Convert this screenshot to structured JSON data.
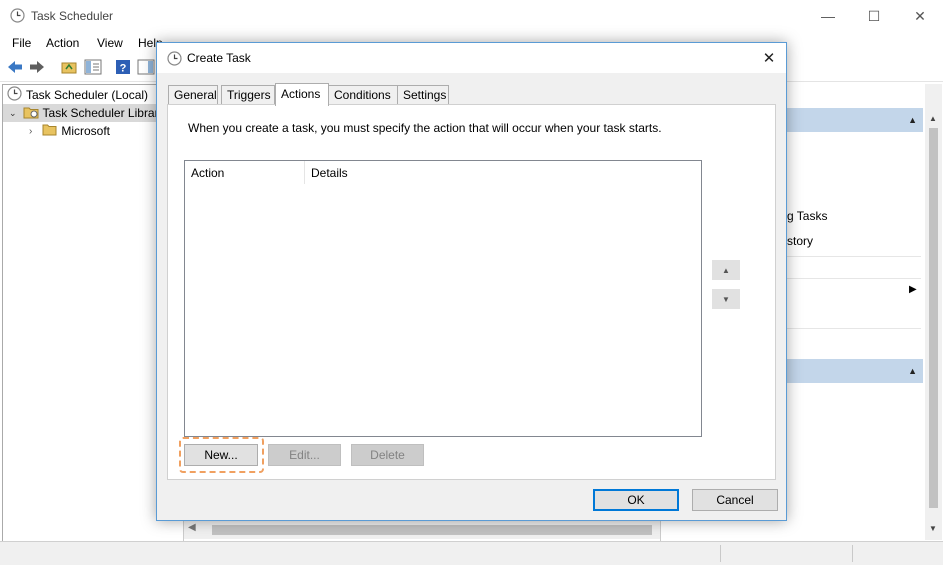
{
  "app": {
    "title": "Task Scheduler",
    "window_controls": {
      "minimize": "—",
      "maximize": "☐",
      "close": "✕"
    }
  },
  "menu": [
    "File",
    "Action",
    "View",
    "Help"
  ],
  "tree": {
    "root": "Task Scheduler (Local)",
    "library": "Task Scheduler Library",
    "child": "Microsoft"
  },
  "right_pane": {
    "visible_fragments": [
      "g Tasks",
      "story"
    ]
  },
  "dialog": {
    "title": "Create Task",
    "close": "✕",
    "tabs": [
      "General",
      "Triggers",
      "Actions",
      "Conditions",
      "Settings"
    ],
    "active_tab": "Actions",
    "intro": "When you create a task, you must specify the action that will occur when your task starts.",
    "list": {
      "columns": [
        "Action",
        "Details"
      ],
      "rows": []
    },
    "move_up": "▲",
    "move_down": "▼",
    "buttons": {
      "new": "New...",
      "edit": "Edit...",
      "delete": "Delete"
    },
    "ok": "OK",
    "cancel": "Cancel"
  },
  "colors": {
    "accent": "#0078d7",
    "dialog_border": "#5a9bd5",
    "pane_header": "#c3d6ea",
    "highlight": "#f0a060"
  }
}
